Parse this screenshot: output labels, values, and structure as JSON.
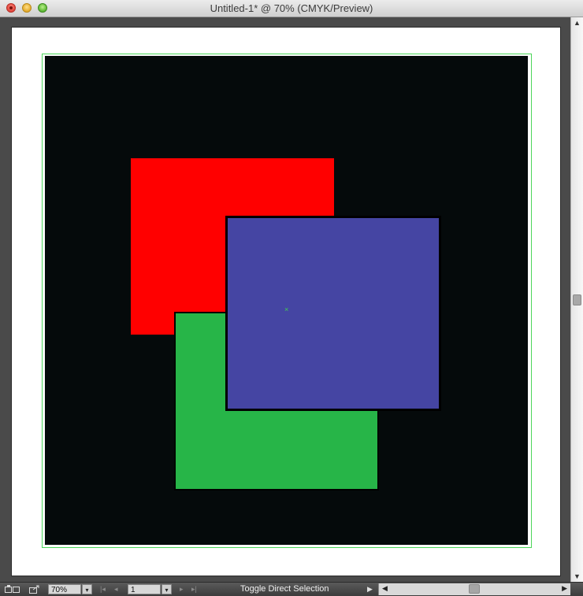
{
  "window": {
    "title": "Untitled-1* @ 70% (CMYK/Preview)"
  },
  "document": {
    "center_marker": "×",
    "colors": {
      "artboard": "#ffffff",
      "background_rect": "#050a0b",
      "red_square": "#ff0000",
      "green_square": "#27b548",
      "blue_square": "#4545a3",
      "guide": "#4cd65a"
    }
  },
  "statusbar": {
    "zoom_value": "70%",
    "zoom_dropdown_icon": "▾",
    "page_value": "1",
    "page_dropdown_icon": "▾",
    "first_icon": "|◂",
    "prev_icon": "◂",
    "next_icon": "▸",
    "last_icon": "▸|",
    "status_text": "Toggle Direct Selection",
    "status_arrow": "▶"
  },
  "scrollbars": {
    "up_icon": "▲",
    "down_icon": "▼",
    "left_icon": "◀",
    "right_icon": "▶"
  }
}
